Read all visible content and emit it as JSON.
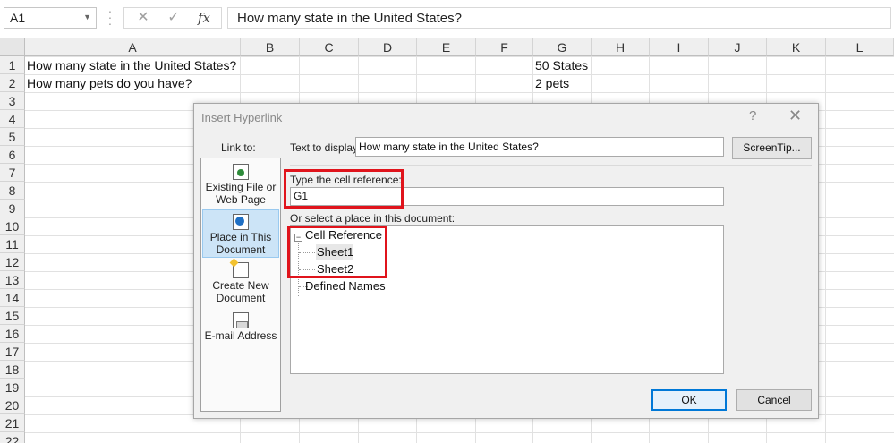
{
  "formula_bar": {
    "name_box": "A1",
    "cancel_glyph": "✕",
    "enter_glyph": "✓",
    "fx_glyph": "fx",
    "formula": "How many state in the United States?"
  },
  "sheet": {
    "columns": [
      "A",
      "B",
      "C",
      "D",
      "E",
      "F",
      "G",
      "H",
      "I",
      "J",
      "K",
      "L"
    ],
    "rows": [
      "1",
      "2",
      "3",
      "4",
      "5",
      "6",
      "7",
      "8",
      "9",
      "10",
      "11",
      "12",
      "13",
      "14",
      "15",
      "16",
      "17",
      "18",
      "19",
      "20",
      "21",
      "22"
    ],
    "cells": {
      "A1": "How many state in the United States?",
      "A2": "How many pets do you have?",
      "G1": "50 States",
      "G2": "2 pets"
    }
  },
  "dialog": {
    "title": "Insert Hyperlink",
    "help": "?",
    "close": "✕",
    "link_to_label": "Link to:",
    "link_items": [
      {
        "line1": "Existing File or",
        "line2": "Web Page",
        "icon": "existing-file-icon"
      },
      {
        "line1": "Place in This",
        "line2": "Document",
        "icon": "place-in-document-icon"
      },
      {
        "line1": "Create New",
        "line2": "Document",
        "icon": "create-new-document-icon"
      },
      {
        "line1": "E-mail Address",
        "line2": "",
        "icon": "email-address-icon"
      }
    ],
    "text_to_display_label": "Text to display:",
    "text_to_display_value": "How many state in the United States?",
    "screentip_label": "ScreenTip...",
    "cell_ref_label": "Type the cell reference:",
    "cell_ref_value": "G1",
    "select_place_label": "Or select a place in this document:",
    "tree": {
      "root": "Cell Reference",
      "children": [
        "Sheet1",
        "Sheet2"
      ],
      "defined_names": "Defined Names",
      "toggle": "−"
    },
    "ok_label": "OK",
    "cancel_label": "Cancel"
  },
  "colors": {
    "highlight": "#e0141c",
    "selected_link": "#cce4f7",
    "ok_border": "#0078d7",
    "excel_green": "#217346"
  }
}
